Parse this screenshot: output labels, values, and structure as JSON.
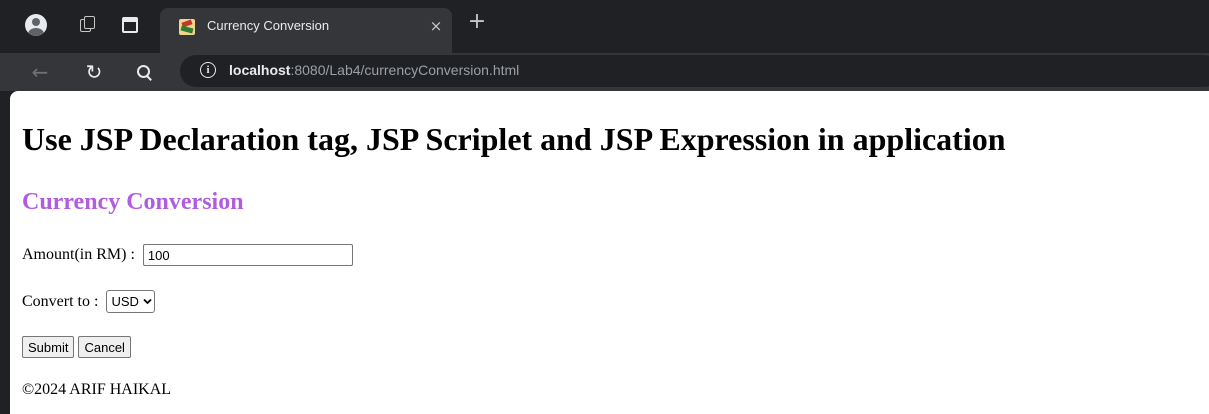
{
  "browser": {
    "tab": {
      "title": "Currency Conversion",
      "close_glyph": "×"
    },
    "new_tab_glyph": "+",
    "toolbar": {
      "back_glyph": "←",
      "reload_glyph": "↻",
      "info_glyph": "i"
    },
    "address": {
      "host": "localhost",
      "rest": ":8080/Lab4/currencyConversion.html"
    }
  },
  "page": {
    "title": "Use JSP Declaration tag, JSP Scriplet and JSP Expression in application",
    "section_title": "Currency Conversion",
    "form": {
      "amount_label": "Amount(in RM) : ",
      "amount_value": "100",
      "convert_label": "Convert to : ",
      "convert_selected": "USD",
      "submit_label": "Submit",
      "cancel_label": "Cancel"
    },
    "footer": "©2024 ARIF HAIKAL"
  },
  "colors": {
    "section_title": "#b05de0",
    "browser_frame": "#202124",
    "toolbar": "#35363a"
  },
  "icons": {
    "profile": "profile-icon",
    "workspaces": "workspaces-icon",
    "tab_search": "tab-search-icon",
    "favicon": "favicon-icon",
    "close": "close-icon",
    "new_tab": "new-tab-icon",
    "back": "back-icon",
    "reload": "reload-icon",
    "search": "search-icon",
    "info": "info-icon",
    "dropdown": "chevron-down-icon"
  }
}
